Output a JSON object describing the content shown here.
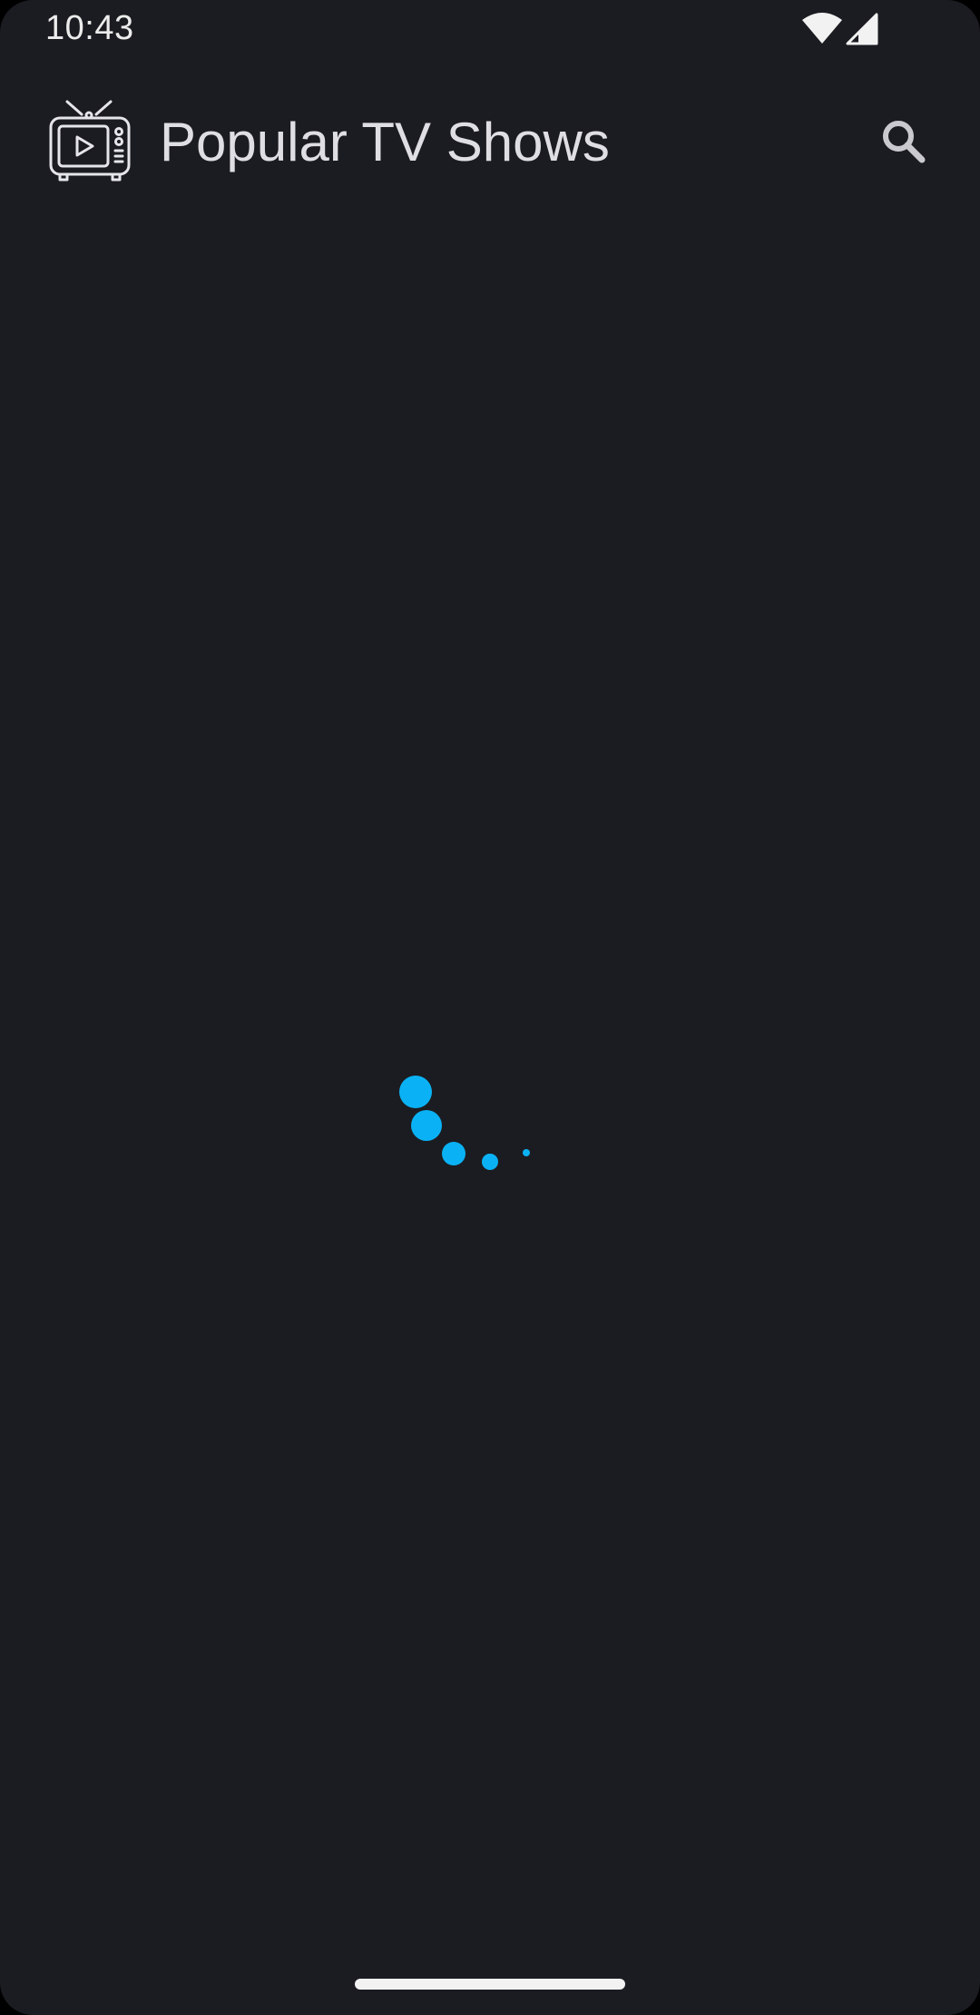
{
  "status_bar": {
    "time": "10:43",
    "icons": [
      "wifi-icon",
      "cellular-signal-icon"
    ]
  },
  "app_bar": {
    "logo_icon": "tv-icon",
    "title": "Popular TV Shows",
    "search_icon": "search-icon"
  },
  "content": {
    "state": "loading",
    "spinner_color": "#0ab2f5"
  },
  "colors": {
    "background": "#1b1c21",
    "title_text": "#dfdfe3",
    "icon": "#c9c9ce",
    "accent": "#0ab2f5"
  }
}
